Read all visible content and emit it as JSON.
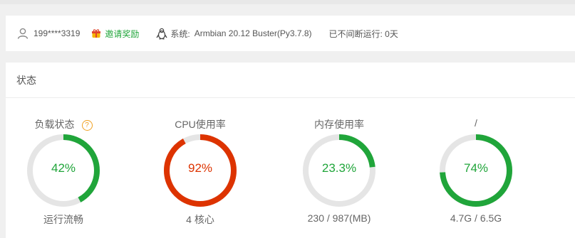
{
  "infobar": {
    "user_icon": "user-icon",
    "user": "199****3319",
    "gift_icon": "gift-icon",
    "invite": "邀请奖励",
    "os_icon": "linux-penguin-icon",
    "system_label": "系统:",
    "system_value": "Armbian 20.12 Buster(Py3.7.8)",
    "uptime": "已不间断运行: 0天"
  },
  "status_panel": {
    "title": "状态",
    "gauges": [
      {
        "title": "负载状态",
        "help_icon": "question-icon",
        "help_mark": "?",
        "value_text": "42%",
        "fraction": 0.42,
        "color": "#20a53a",
        "subtitle": "运行流畅"
      },
      {
        "title": "CPU使用率",
        "value_text": "92%",
        "fraction": 0.92,
        "color": "#dd3300",
        "subtitle": "4 核心"
      },
      {
        "title": "内存使用率",
        "value_text": "23.3%",
        "fraction": 0.233,
        "color": "#20a53a",
        "subtitle": "230 / 987(MB)"
      },
      {
        "title": "/",
        "value_text": "74%",
        "fraction": 0.74,
        "color": "#20a53a",
        "subtitle": "4.7G / 6.5G"
      }
    ],
    "track_color": "#e5e5e5"
  }
}
